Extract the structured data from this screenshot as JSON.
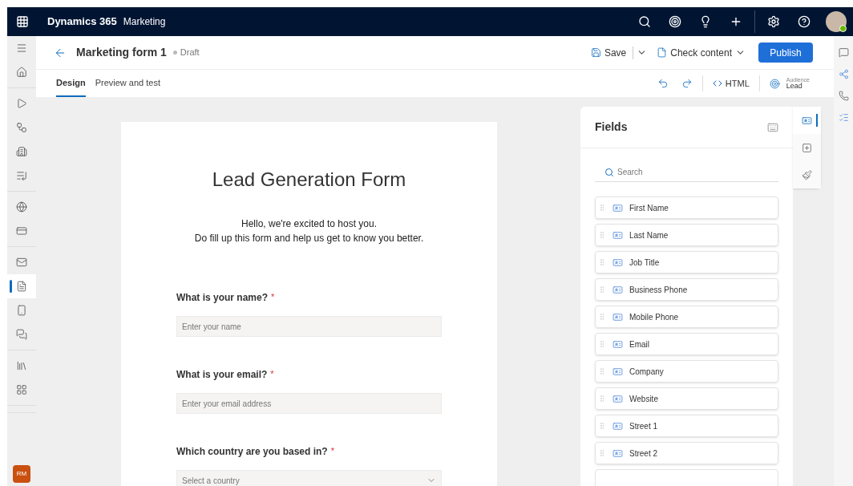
{
  "topbar": {
    "brand": "Dynamics 365",
    "app": "Marketing",
    "avatar_online": true
  },
  "rail": [
    {
      "kind": "menu",
      "selected": false
    },
    {
      "kind": "home",
      "selected": false
    },
    {
      "kind": "divider"
    },
    {
      "kind": "play",
      "selected": false
    },
    {
      "kind": "journey",
      "selected": false
    },
    {
      "kind": "building",
      "selected": false
    },
    {
      "kind": "trigger",
      "selected": false
    },
    {
      "kind": "divider"
    },
    {
      "kind": "globe",
      "selected": false
    },
    {
      "kind": "card",
      "selected": false
    },
    {
      "kind": "divider"
    },
    {
      "kind": "mail",
      "selected": false
    },
    {
      "kind": "form",
      "selected": true
    },
    {
      "kind": "phone",
      "selected": false
    },
    {
      "kind": "chat",
      "selected": false
    },
    {
      "kind": "divider"
    },
    {
      "kind": "library",
      "selected": false
    },
    {
      "kind": "grid",
      "selected": false
    },
    {
      "kind": "divider"
    },
    {
      "kind": "divider"
    }
  ],
  "user_initials": "RM",
  "header": {
    "title": "Marketing form 1",
    "status": "Draft",
    "save": "Save",
    "check": "Check content",
    "publish": "Publish"
  },
  "tabs": [
    {
      "label": "Design",
      "selected": true
    },
    {
      "label": "Preview and test",
      "selected": false
    }
  ],
  "toolbar": {
    "html": "HTML",
    "audience_label": "Audience",
    "audience": "Lead"
  },
  "required_mark": "*",
  "form": {
    "title": "Lead Generation Form",
    "intro": [
      "Hello, we're excited to host you.",
      "Do fill up this form and help us get to know you better."
    ],
    "questions": [
      {
        "kind": "text",
        "label": "What is your name?",
        "required": true,
        "placeholder": "Enter your name"
      },
      {
        "kind": "text",
        "label": "What is your email?",
        "required": true,
        "placeholder": "Enter your email address"
      },
      {
        "kind": "select",
        "label": "Which country are you based in?",
        "required": true,
        "placeholder": "Select a country"
      }
    ]
  },
  "fields_panel": {
    "title": "Fields",
    "search_placeholder": "Search",
    "fields": [
      "First Name",
      "Last Name",
      "Job Title",
      "Business Phone",
      "Mobile Phone",
      "Email",
      "Company",
      "Website",
      "Street 1",
      "Street 2"
    ],
    "side_tabs": [
      {
        "kind": "fields",
        "selected": true
      },
      {
        "kind": "add",
        "selected": false
      },
      {
        "kind": "style",
        "selected": false
      }
    ]
  }
}
